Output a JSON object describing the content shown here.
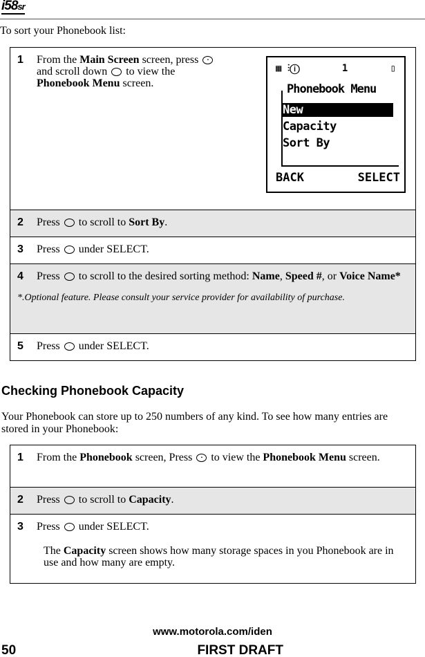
{
  "header": {
    "logo": "i58",
    "logo_suffix": "sr"
  },
  "intro": "To sort your Phonebook list:",
  "sort_steps": [
    {
      "num": "1",
      "pre": "From the ",
      "b1": "Main Screen",
      "mid": " screen, press ",
      "mid2": " and scroll down ",
      "mid3": " to view the ",
      "b2": "Phonebook Menu",
      "post": " screen."
    },
    {
      "num": "2",
      "pre": "Press ",
      "mid": " to scroll to ",
      "b1": "Sort By",
      "post": "."
    },
    {
      "num": "3",
      "pre": "Press ",
      "post": " under SELECT."
    },
    {
      "num": "4",
      "pre": "Press ",
      "mid": " to scroll to the desired sorting method: ",
      "b1": "Name",
      "c1": ", ",
      "b2": "Speed #",
      "c2": ", or ",
      "b3": "Voice Name*",
      "note": "*.Optional feature. Please consult your service provider for availability of purchase."
    },
    {
      "num": "5",
      "pre": "Press ",
      "post": " under SELECT."
    }
  ],
  "phone_screen": {
    "signal_indicator": "1",
    "title": "Phonebook Menu",
    "items": [
      "New",
      "Capacity",
      "Sort By"
    ],
    "selected": "New",
    "left_soft": "BACK",
    "right_soft": "SELECT"
  },
  "capacity": {
    "heading": "Checking Phonebook Capacity",
    "para": "Your Phonebook can store up to 250 numbers of any kind. To see how many entries are stored in your Phonebook:",
    "steps": [
      {
        "num": "1",
        "pre": "From the ",
        "b1": "Phonebook",
        "mid": " screen, Press ",
        "mid2": " to view the ",
        "b2": "Phonebook Menu",
        "post": " screen."
      },
      {
        "num": "2",
        "pre": "Press ",
        "mid": " to scroll to ",
        "b1": "Capacity",
        "post": "."
      },
      {
        "num": "3",
        "pre": "Press ",
        "post": " under SELECT.",
        "p2pre": "The ",
        "p2b": "Capacity",
        "p2post": " screen shows how many storage spaces in you Phonebook are in use and how many are empty."
      }
    ]
  },
  "footer": {
    "url": "www.motorola.com/iden",
    "page": "50",
    "draft": "FIRST DRAFT"
  }
}
